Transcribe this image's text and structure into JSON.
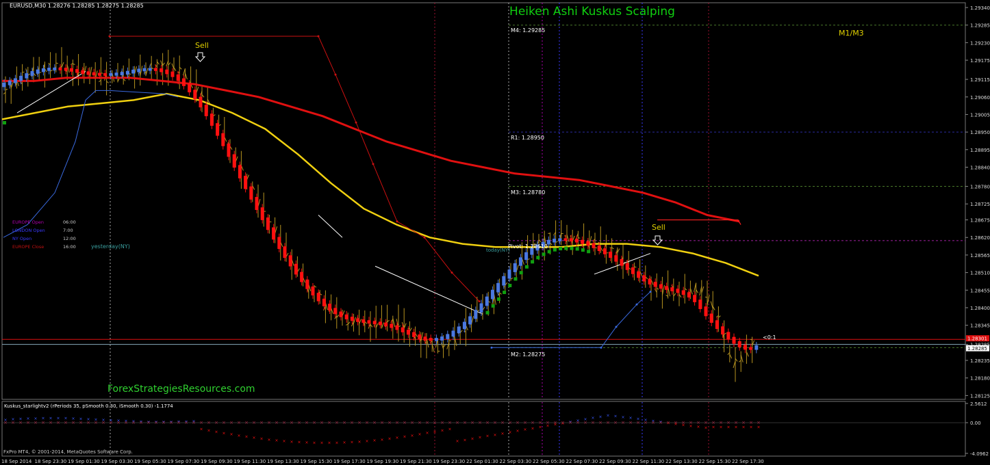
{
  "window": {
    "symbol_info": "EURUSD,M30  1.28276 1.28285 1.28275 1.28285",
    "title": "Heiken Ashi Kuskus Scalping",
    "tf_label": "M1/M3",
    "watermark": "ForexStrategiesResources.com",
    "copyright": "FxPro MT4, © 2001-2014, MetaQuotes Software Corp.",
    "indicator_label": "Kuskus_starlightv2  (rPeriods 35, pSmooth 0.30, iSmooth 0.30)  -1.1774",
    "ratio_label": "<0:1",
    "yesterday_label": "yesterday(NY)",
    "today_label": "today(NY)",
    "sell_labels": [
      "Sell",
      "Sell"
    ]
  },
  "sessions": [
    {
      "name": "EUROPE Open",
      "time": "06:00",
      "color": "#b000b0"
    },
    {
      "name": "LONDON Open",
      "time": "7:00",
      "color": "#3a3aff"
    },
    {
      "name": "NY Open",
      "time": "12:00",
      "color": "#3a3aff"
    },
    {
      "name": "EUROPE Close",
      "time": "16:00",
      "color": "#c01010"
    }
  ],
  "pivots": [
    {
      "label": "M4: 1.29285",
      "value": 1.29285,
      "color": "#4a7a2a"
    },
    {
      "label": "R1: 1.28950",
      "value": 1.2895,
      "color": "#2a2aa0"
    },
    {
      "label": "M3: 1.28780",
      "value": 1.2878,
      "color": "#4a7a2a"
    },
    {
      "label": "Pivot: 1.28610",
      "value": 1.2861,
      "color": "#a020a0"
    },
    {
      "label": "M2: 1.28275",
      "value": 1.28275,
      "color": "#4a7a2a"
    }
  ],
  "colors": {
    "background": "#000000",
    "grid_day": "#888888",
    "bear_candle": "#ff1010",
    "bull_candle": "#4a78e0",
    "bull_dot": "#10a010",
    "bar": "#b89520",
    "ma_red": "#e01010",
    "ma_yellow": "#f0d010",
    "title": "#10d010",
    "tf": "#e0d000",
    "watermark": "#30d030",
    "white": "#ffffff"
  },
  "chart_data": {
    "type": "line",
    "title": "Heiken Ashi Kuskus Scalping",
    "y_axis": {
      "ticks": [
        "1.29340",
        "1.29285",
        "1.29230",
        "1.29175",
        "1.29115",
        "1.29060",
        "1.29005",
        "1.28950",
        "1.28895",
        "1.28840",
        "1.28780",
        "1.28725",
        "1.28675",
        "1.28620",
        "1.28565",
        "1.28510",
        "1.28455",
        "1.28400",
        "1.28345",
        "1.28285",
        "1.28235",
        "1.28180",
        "1.28125"
      ],
      "min": 1.28125,
      "max": 1.2934
    },
    "x_axis": {
      "ticks": [
        "18 Sep 2014",
        "18 Sep 23:30",
        "19 Sep 01:30",
        "19 Sep 03:30",
        "19 Sep 05:30",
        "19 Sep 07:30",
        "19 Sep 09:30",
        "19 Sep 11:30",
        "19 Sep 13:30",
        "19 Sep 15:30",
        "19 Sep 17:30",
        "19 Sep 19:30",
        "19 Sep 21:30",
        "19 Sep 23:30",
        "22 Sep 01:30",
        "22 Sep 03:30",
        "22 Sep 05:30",
        "22 Sep 07:30",
        "22 Sep 09:30",
        "22 Sep 11:30",
        "22 Sep 13:30",
        "22 Sep 15:30",
        "22 Sep 17:30"
      ]
    },
    "price_labels": [
      {
        "label": "1.28301",
        "value": 1.28301,
        "color": "#e01010"
      },
      {
        "label": "1.28285",
        "value": 1.28285,
        "color": "#ffffff"
      }
    ],
    "series": [
      {
        "name": "ma_red",
        "values": [
          1.2911,
          1.2911,
          1.2912,
          1.2912,
          1.2912,
          1.2911,
          1.291,
          1.2908,
          1.2906,
          1.2903,
          1.29,
          1.2896,
          1.2892,
          1.2889,
          1.2886,
          1.2884,
          1.2882,
          1.2881,
          1.288,
          1.2878,
          1.2876,
          1.2873,
          1.2869,
          1.2867
        ]
      },
      {
        "name": "ma_yellow",
        "values": [
          1.2899,
          1.2901,
          1.2903,
          1.2904,
          1.2905,
          1.2907,
          1.2905,
          1.2901,
          1.2896,
          1.2888,
          1.2879,
          1.2871,
          1.2866,
          1.2862,
          1.286,
          1.2859,
          1.2859,
          1.2859,
          1.286,
          1.286,
          1.2859,
          1.2857,
          1.2854,
          1.285
        ]
      }
    ],
    "oscillator": {
      "name": "Kuskus_starlightv2",
      "ticks": [
        "2.5612",
        "0.00",
        "-4.0962"
      ],
      "min": -4.0962,
      "max": 2.5612
    }
  }
}
